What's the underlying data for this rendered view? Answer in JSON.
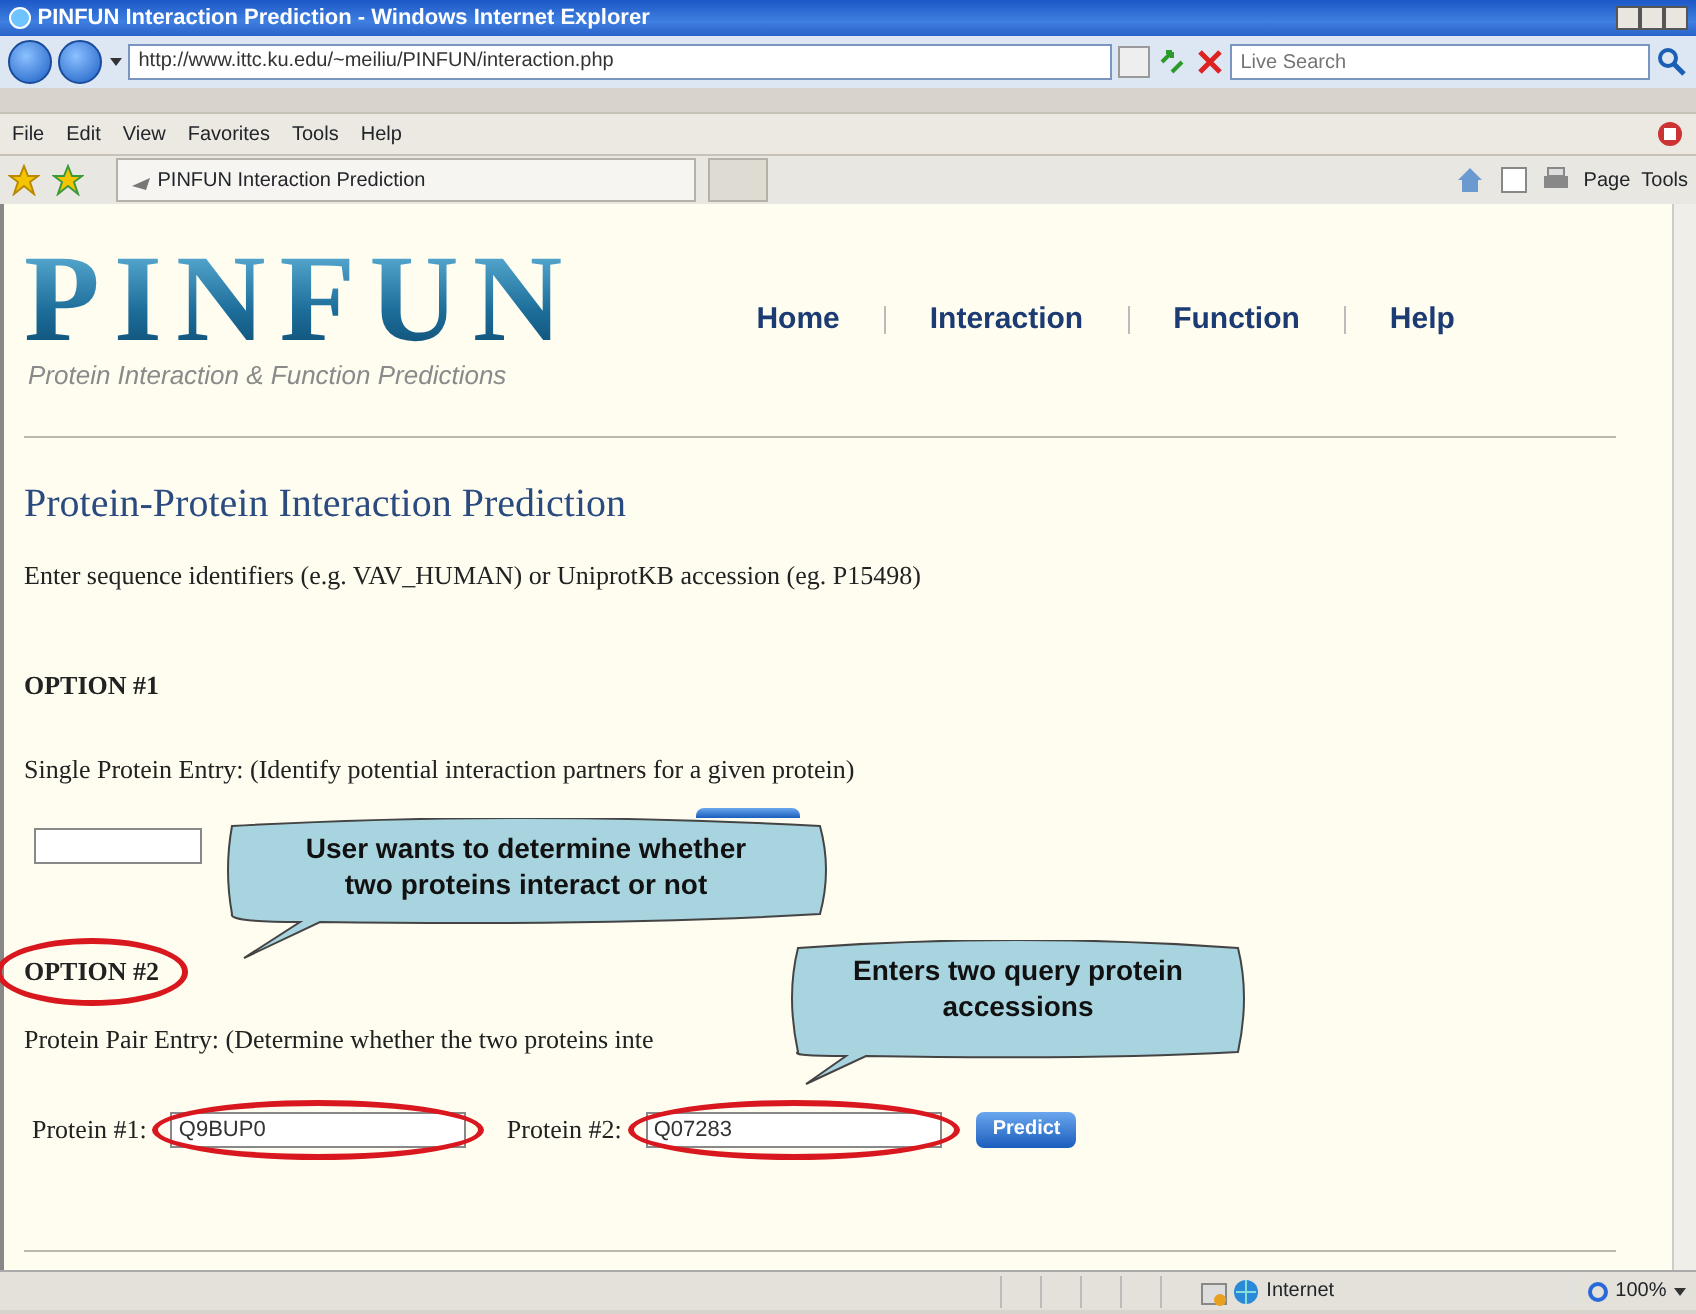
{
  "window": {
    "title": "PINFUN Interaction Prediction - Windows Internet Explorer"
  },
  "address_bar": {
    "url": "http://www.ittc.ku.edu/~meiliu/PINFUN/interaction.php"
  },
  "search": {
    "placeholder": "Live Search"
  },
  "menu": [
    "File",
    "Edit",
    "View",
    "Favorites",
    "Tools",
    "Help"
  ],
  "tab": {
    "title": "PINFUN Interaction Prediction"
  },
  "command_bar": [
    "Page",
    "Tools"
  ],
  "site": {
    "logo": "PINFUN",
    "tagline": "Protein Interaction & Function Predictions",
    "nav": [
      "Home",
      "Interaction",
      "Function",
      "Help"
    ]
  },
  "heading": "Protein-Protein Interaction Prediction",
  "intro": "Enter sequence identifiers (e.g. VAV_HUMAN) or UniprotKB accession (eg. P15498)",
  "option1": {
    "title": "OPTION #1",
    "description": "Single Protein Entry: (Identify potential interaction partners for a given protein)"
  },
  "option2": {
    "title": "OPTION #2",
    "description": "Protein Pair Entry: (Determine whether the two proteins inte",
    "fields": [
      {
        "label": "Protein #1:",
        "value": "Q9BUP0"
      },
      {
        "label": "Protein #2:",
        "value": "Q07283"
      }
    ],
    "button": "Predict"
  },
  "annotations": [
    {
      "text": "User wants to determine whether two proteins interact or not"
    },
    {
      "text": "Enters two query protein accessions"
    }
  ],
  "status_bar": {
    "zone": "Internet",
    "zoom": "100%"
  }
}
